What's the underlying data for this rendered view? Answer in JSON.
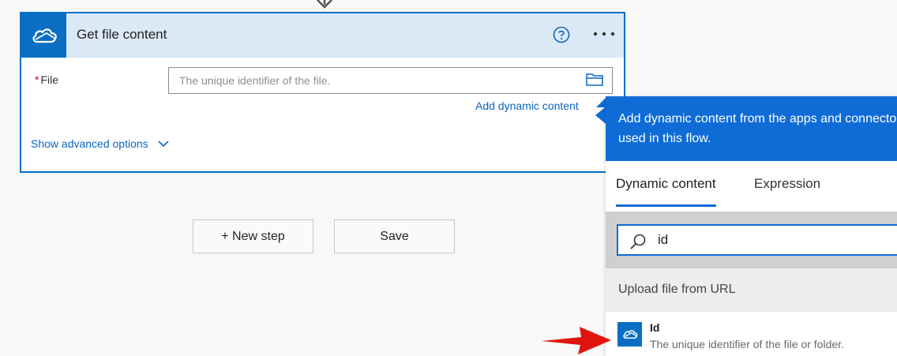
{
  "action": {
    "title": "Get file content",
    "file_label": "File",
    "required_marker": "*",
    "file_placeholder": "The unique identifier of the file.",
    "add_dynamic_label": "Add dynamic content",
    "show_advanced_label": "Show advanced options",
    "icon": "onedrive-cloud-icon"
  },
  "buttons": {
    "new_step": "+ New step",
    "save": "Save"
  },
  "panel": {
    "header_line1": "Add dynamic content from the apps and connectors",
    "header_line2": "used in this flow.",
    "tabs": [
      {
        "label": "Dynamic content",
        "active": true
      },
      {
        "label": "Expression",
        "active": false
      }
    ],
    "search_value": "id",
    "section_title": "Upload file from URL",
    "results": [
      {
        "title": "Id",
        "description": "The unique identifier of the file or folder."
      }
    ]
  },
  "colors": {
    "accent": "#0f6cd6",
    "card_border": "#0072c6",
    "header_bg": "#dbe9f6",
    "link": "#0a66c2",
    "annotation_arrow": "#e0150f"
  }
}
